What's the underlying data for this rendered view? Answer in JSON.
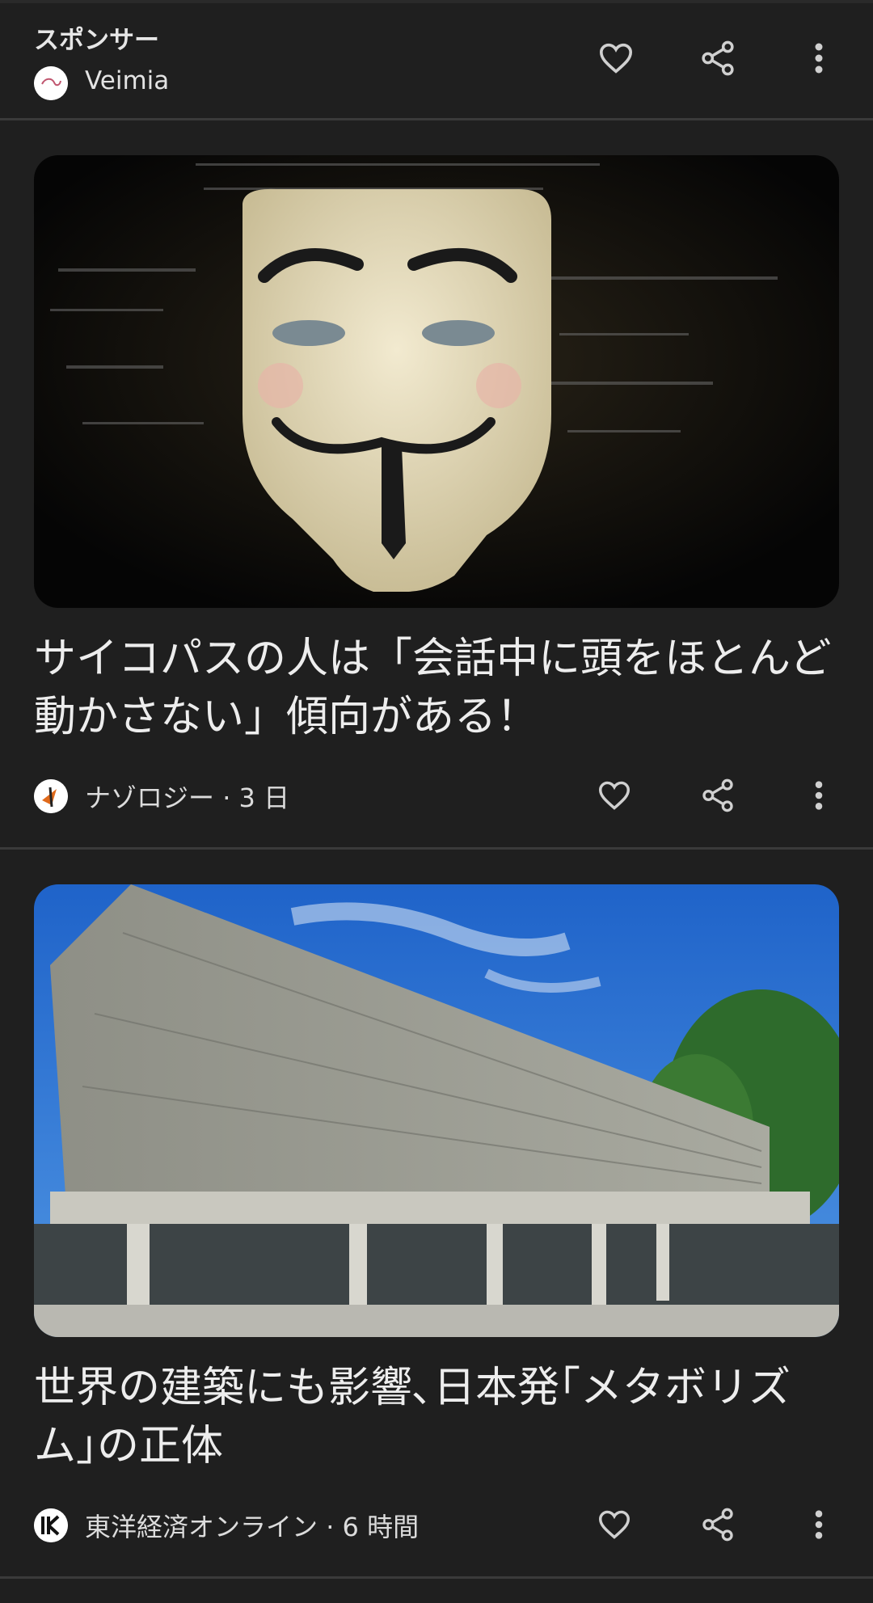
{
  "sponsor": {
    "label": "スポンサー",
    "name": "Veimia"
  },
  "cards": [
    {
      "title": "サイコパスの人は「会話中に頭をほとんど動かさない」傾向がある！",
      "source": "ナゾロジー",
      "age": "3 日",
      "image": "guy-fawkes-mask-hacker-image"
    },
    {
      "title": "世界の建築にも影響､日本発｢メタボリズム｣の正体",
      "source": "東洋経済オンライン",
      "age": "6 時間",
      "image": "concrete-museum-building-image"
    }
  ],
  "icons": {
    "like": "heart-icon",
    "share": "share-icon",
    "more": "more-vert-icon"
  },
  "colors": {
    "background": "#1f1f1f",
    "text": "#e3e3e3",
    "divider": "#3a3a3a"
  }
}
